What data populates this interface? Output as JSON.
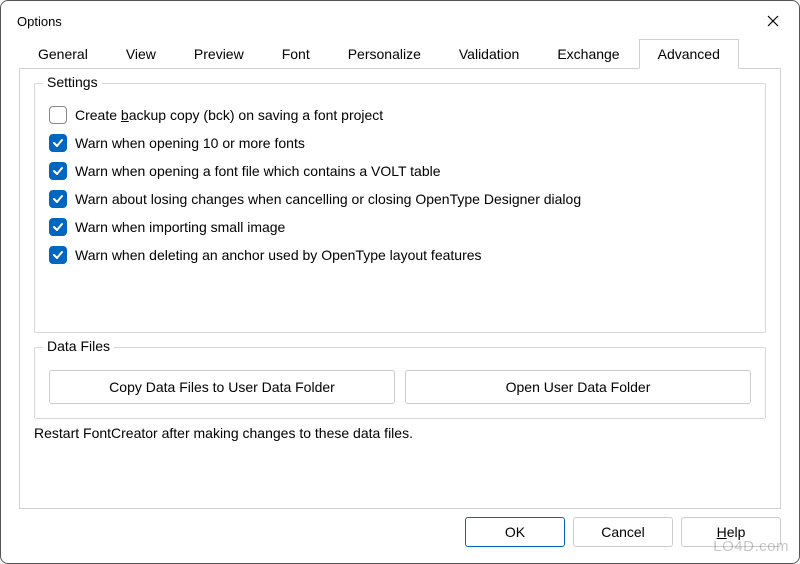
{
  "window": {
    "title": "Options"
  },
  "tabs": [
    {
      "label": "General"
    },
    {
      "label": "View"
    },
    {
      "label": "Preview"
    },
    {
      "label": "Font"
    },
    {
      "label": "Personalize"
    },
    {
      "label": "Validation"
    },
    {
      "label": "Exchange"
    },
    {
      "label": "Advanced",
      "active": true
    }
  ],
  "settings": {
    "title": "Settings",
    "items": [
      {
        "checked": false,
        "label": "Create backup copy (bck) on saving a font project"
      },
      {
        "checked": true,
        "label": "Warn when opening 10 or more fonts"
      },
      {
        "checked": true,
        "label": "Warn when opening a font file which contains a VOLT table"
      },
      {
        "checked": true,
        "label": "Warn about losing changes when cancelling or closing OpenType Designer dialog"
      },
      {
        "checked": true,
        "label": "Warn when importing small image"
      },
      {
        "checked": true,
        "label": "Warn when deleting an anchor used by OpenType layout features"
      }
    ]
  },
  "dataFiles": {
    "title": "Data Files",
    "copyBtn": "Copy Data Files to User Data Folder",
    "openBtn": "Open User Data Folder",
    "note": "Restart FontCreator after making changes to these data files."
  },
  "buttons": {
    "ok": "OK",
    "cancel": "Cancel",
    "help": "Help"
  },
  "watermark": "LO4D.com"
}
